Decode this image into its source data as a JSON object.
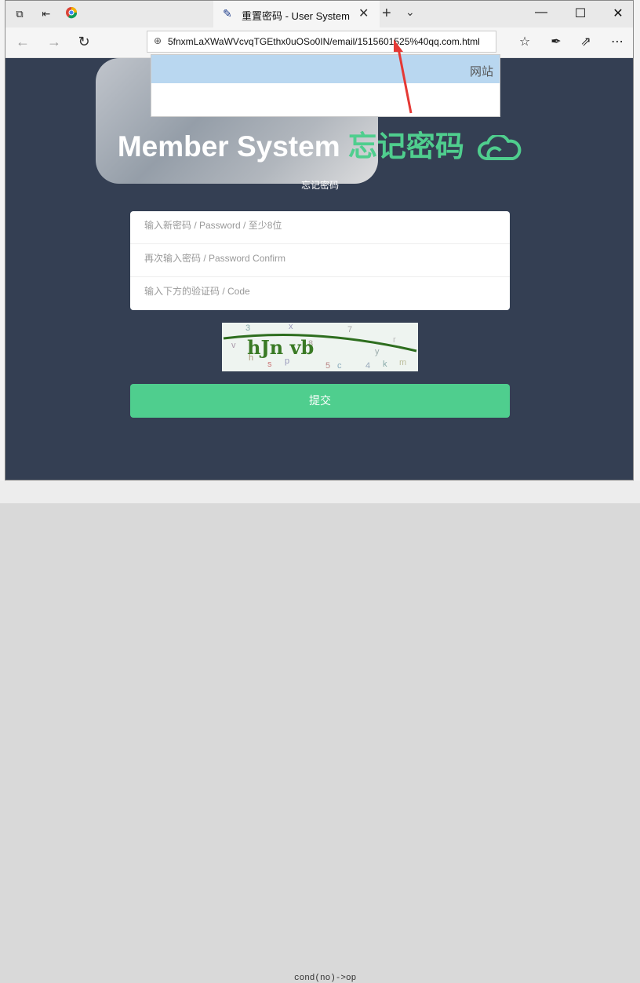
{
  "browser": {
    "tab_title": "重置密码 - User System",
    "address_url": "5fnxmLaXWaWVcvqTGEthx0uOSo0IN/email/1515601525%40qq.com.html",
    "dropdown_suggestion": "网站",
    "icons": {
      "tab_favicon": "pin-icon",
      "back": "back-arrow-icon",
      "forward": "forward-arrow-icon",
      "refresh": "refresh-icon",
      "favorites": "star-icon",
      "notes": "pen-icon",
      "share": "share-icon",
      "more": "more-icon"
    }
  },
  "page": {
    "headline_white": "Member System",
    "headline_green": "忘记密码",
    "subtitle": "忘记密码",
    "fields": {
      "password_placeholder": "输入新密码 / Password / 至少8位",
      "confirm_placeholder": "再次输入密码 / Password Confirm",
      "code_placeholder": "输入下方的验证码 / Code"
    },
    "captcha_text": "hJn vb",
    "submit_label": "提交"
  },
  "background": {
    "bottom_snippet": "cond(no)->op"
  },
  "colors": {
    "page_bg": "#343f53",
    "accent_green": "#4fce8e",
    "annotation_red": "#e53935"
  }
}
